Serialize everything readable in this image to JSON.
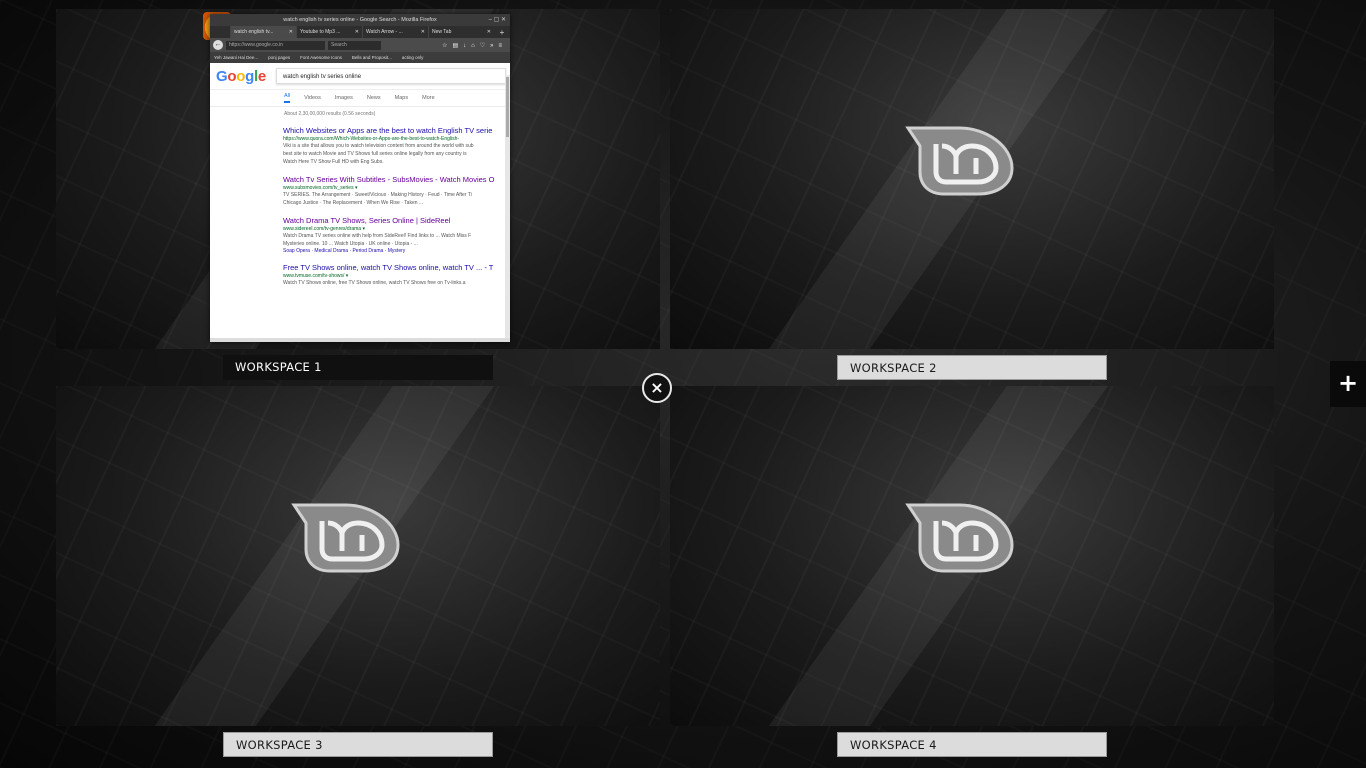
{
  "workspaces": [
    {
      "label": "WORKSPACE 1",
      "active": true
    },
    {
      "label": "WORKSPACE 2",
      "active": false
    },
    {
      "label": "WORKSPACE 3",
      "active": false
    },
    {
      "label": "WORKSPACE 4",
      "active": false
    }
  ],
  "controls": {
    "close": "×",
    "add": "+"
  },
  "browser": {
    "window_title": "watch english tv series online - Google Search - Mozilla Firefox",
    "tabs": [
      {
        "label": "watch english tv..."
      },
      {
        "label": "Youtube to Mp3 ..."
      },
      {
        "label": "Watch Arrow - ..."
      },
      {
        "label": "New Tab"
      }
    ],
    "url": "https://www.google.co.in",
    "search_placeholder": "Search",
    "bookmarks": [
      "Yeh Jawani Hai Dee...",
      "ponj pages",
      "Font Awesome Icons",
      "Bells and Proposit...",
      "acting only"
    ],
    "query": "watch english tv series online",
    "search_tabs": [
      "All",
      "Videos",
      "Images",
      "News",
      "Maps",
      "More"
    ],
    "stats": "About 2,30,00,000 results (0.56 seconds)",
    "results": [
      {
        "title": "Which Websites or Apps are the best to watch English TV serie",
        "url": "https://www.quora.com/Which-Websites-or-Apps-are-the-best-to-watch-English-",
        "snippet1": "Viki is a site that allows you to watch television content from around the world with sub",
        "snippet2": "best site to watch Movie and TV Shows full series online legally from any country is",
        "snippet3": "Watch Here TV Show Full HD with Eng Subs."
      },
      {
        "title": "Watch Tv Series With Subtitles - SubsMovies - Watch Movies O",
        "url": "www.subsmovies.com/tv_series ▾",
        "snippet1": "TV SERIES. The Arrangement · Sweet/Vicious · Making History · Feud · Time After Ti",
        "snippet2": "Chicago Justice · The Replacement · When We Rise · Taken ..."
      },
      {
        "title": "Watch Drama TV Shows, Series Online | SideReel",
        "url": "www.sidereel.com/tv-genres/drama ▾",
        "snippet1": "Watch Drama TV series online with help from SideReel! Find links to ... Watch Miss F",
        "snippet2": "Mysteries online. 10 ... Watch Utopia · UK online · Utopia - ...",
        "links": "Soap Opera · Medical Drama · Period Drama · Mystery"
      },
      {
        "title": "Free TV Shows online, watch TV Shows online, watch TV ... - T",
        "url": "www.tvmuse.com/tv-shows/ ▾",
        "snippet1": "Watch TV Shows online, free TV Shows online, watch TV Shows free on Tv-links.a"
      }
    ]
  }
}
